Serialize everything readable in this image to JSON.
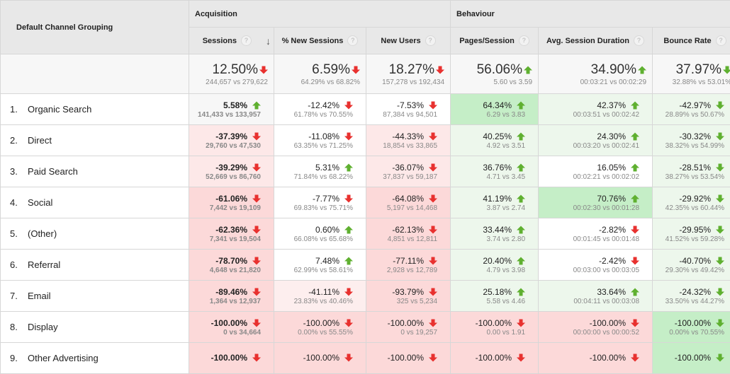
{
  "header": {
    "dimension_label": "Default Channel Grouping",
    "groups": [
      {
        "label": "Acquisition"
      },
      {
        "label": "Behaviour"
      }
    ],
    "metrics": [
      {
        "label": "Sessions",
        "help_icon": "question-icon",
        "sort_icon": "arrow-down-icon"
      },
      {
        "label": "% New Sessions",
        "help_icon": "question-icon"
      },
      {
        "label": "New Users",
        "help_icon": "question-icon"
      },
      {
        "label": "Pages/Session",
        "help_icon": "question-icon"
      },
      {
        "label": "Avg. Session Duration",
        "help_icon": "question-icon"
      },
      {
        "label": "Bounce Rate",
        "help_icon": "question-icon"
      }
    ],
    "help_glyph": "?",
    "sort_glyph": "↓"
  },
  "colors": {
    "arrow_red": "#e8312f",
    "arrow_green": "#5fb030",
    "red_light": "#fde8e8",
    "red_mid": "#fcd9d9",
    "green_strong": "#c5eec7",
    "green_light": "#edf7ec"
  },
  "totals": [
    {
      "value": "12.50%",
      "compare": "244,657 vs 279,622",
      "dir": "down",
      "color": "red"
    },
    {
      "value": "6.59%",
      "compare": "64.29% vs 68.82%",
      "dir": "down",
      "color": "red"
    },
    {
      "value": "18.27%",
      "compare": "157,278 vs 192,434",
      "dir": "down",
      "color": "red"
    },
    {
      "value": "56.06%",
      "compare": "5.60 vs 3.59",
      "dir": "up",
      "color": "green"
    },
    {
      "value": "34.90%",
      "compare": "00:03:21 vs 00:02:29",
      "dir": "up",
      "color": "green"
    },
    {
      "value": "37.97%",
      "compare": "32.88% vs 53.01%",
      "dir": "down",
      "color": "green"
    }
  ],
  "rows": [
    {
      "index": "1.",
      "channel": "Organic Search",
      "cells": [
        {
          "value": "5.58%",
          "compare": "141,433 vs 133,957",
          "dir": "up",
          "color": "green",
          "bg": "n"
        },
        {
          "value": "-12.42%",
          "compare": "61.78% vs 70.55%",
          "dir": "down",
          "color": "red",
          "bg": "w"
        },
        {
          "value": "-7.53%",
          "compare": "87,384 vs 94,501",
          "dir": "down",
          "color": "red",
          "bg": "w"
        },
        {
          "value": "64.34%",
          "compare": "6.29 vs 3.83",
          "dir": "up",
          "color": "green",
          "bg": "g1"
        },
        {
          "value": "42.37%",
          "compare": "00:03:51 vs 00:02:42",
          "dir": "up",
          "color": "green",
          "bg": "g2"
        },
        {
          "value": "-42.97%",
          "compare": "28.89% vs 50.67%",
          "dir": "down",
          "color": "green",
          "bg": "g2"
        }
      ]
    },
    {
      "index": "2.",
      "channel": "Direct",
      "cells": [
        {
          "value": "-37.39%",
          "compare": "29,760 vs 47,530",
          "dir": "down",
          "color": "red",
          "bg": "r1"
        },
        {
          "value": "-11.08%",
          "compare": "63.35% vs 71.25%",
          "dir": "down",
          "color": "red",
          "bg": "w"
        },
        {
          "value": "-44.33%",
          "compare": "18,854 vs 33,865",
          "dir": "down",
          "color": "red",
          "bg": "r1"
        },
        {
          "value": "40.25%",
          "compare": "4.92 vs 3.51",
          "dir": "up",
          "color": "green",
          "bg": "g2"
        },
        {
          "value": "24.30%",
          "compare": "00:03:20 vs 00:02:41",
          "dir": "up",
          "color": "green",
          "bg": "g2"
        },
        {
          "value": "-30.32%",
          "compare": "38.32% vs 54.99%",
          "dir": "down",
          "color": "green",
          "bg": "g2"
        }
      ]
    },
    {
      "index": "3.",
      "channel": "Paid Search",
      "cells": [
        {
          "value": "-39.29%",
          "compare": "52,669 vs 86,760",
          "dir": "down",
          "color": "red",
          "bg": "r1"
        },
        {
          "value": "5.31%",
          "compare": "71.84% vs 68.22%",
          "dir": "up",
          "color": "green",
          "bg": "w"
        },
        {
          "value": "-36.07%",
          "compare": "37,837 vs 59,187",
          "dir": "down",
          "color": "red",
          "bg": "r1"
        },
        {
          "value": "36.76%",
          "compare": "4.71 vs 3.45",
          "dir": "up",
          "color": "green",
          "bg": "g2"
        },
        {
          "value": "16.05%",
          "compare": "00:02:21 vs 00:02:02",
          "dir": "up",
          "color": "green",
          "bg": "w"
        },
        {
          "value": "-28.51%",
          "compare": "38.27% vs 53.54%",
          "dir": "down",
          "color": "green",
          "bg": "g2"
        }
      ]
    },
    {
      "index": "4.",
      "channel": "Social",
      "cells": [
        {
          "value": "-61.06%",
          "compare": "7,442 vs 19,109",
          "dir": "down",
          "color": "red",
          "bg": "r2"
        },
        {
          "value": "-7.77%",
          "compare": "69.83% vs 75.71%",
          "dir": "down",
          "color": "red",
          "bg": "w"
        },
        {
          "value": "-64.08%",
          "compare": "5,197 vs 14,468",
          "dir": "down",
          "color": "red",
          "bg": "r2"
        },
        {
          "value": "41.19%",
          "compare": "3.87 vs 2.74",
          "dir": "up",
          "color": "green",
          "bg": "g2"
        },
        {
          "value": "70.76%",
          "compare": "00:02:30 vs 00:01:28",
          "dir": "up",
          "color": "green",
          "bg": "g1"
        },
        {
          "value": "-29.92%",
          "compare": "42.35% vs 60.44%",
          "dir": "down",
          "color": "green",
          "bg": "g2"
        }
      ]
    },
    {
      "index": "5.",
      "channel": "(Other)",
      "cells": [
        {
          "value": "-62.36%",
          "compare": "7,341 vs 19,504",
          "dir": "down",
          "color": "red",
          "bg": "r2"
        },
        {
          "value": "0.60%",
          "compare": "66.08% vs 65.68%",
          "dir": "up",
          "color": "green",
          "bg": "w"
        },
        {
          "value": "-62.13%",
          "compare": "4,851 vs 12,811",
          "dir": "down",
          "color": "red",
          "bg": "r2"
        },
        {
          "value": "33.44%",
          "compare": "3.74 vs 2.80",
          "dir": "up",
          "color": "green",
          "bg": "g2"
        },
        {
          "value": "-2.82%",
          "compare": "00:01:45 vs 00:01:48",
          "dir": "down",
          "color": "red",
          "bg": "w"
        },
        {
          "value": "-29.95%",
          "compare": "41.52% vs 59.28%",
          "dir": "down",
          "color": "green",
          "bg": "g2"
        }
      ]
    },
    {
      "index": "6.",
      "channel": "Referral",
      "cells": [
        {
          "value": "-78.70%",
          "compare": "4,648 vs 21,820",
          "dir": "down",
          "color": "red",
          "bg": "r2"
        },
        {
          "value": "7.48%",
          "compare": "62.99% vs 58.61%",
          "dir": "up",
          "color": "green",
          "bg": "w"
        },
        {
          "value": "-77.11%",
          "compare": "2,928 vs 12,789",
          "dir": "down",
          "color": "red",
          "bg": "r2"
        },
        {
          "value": "20.40%",
          "compare": "4.79 vs 3.98",
          "dir": "up",
          "color": "green",
          "bg": "g2"
        },
        {
          "value": "-2.42%",
          "compare": "00:03:00 vs 00:03:05",
          "dir": "down",
          "color": "red",
          "bg": "w"
        },
        {
          "value": "-40.70%",
          "compare": "29.30% vs 49.42%",
          "dir": "down",
          "color": "green",
          "bg": "g2"
        }
      ]
    },
    {
      "index": "7.",
      "channel": "Email",
      "cells": [
        {
          "value": "-89.46%",
          "compare": "1,364 vs 12,937",
          "dir": "down",
          "color": "red",
          "bg": "r2"
        },
        {
          "value": "-41.11%",
          "compare": "23.83% vs 40.46%",
          "dir": "down",
          "color": "red",
          "bg": "rw"
        },
        {
          "value": "-93.79%",
          "compare": "325 vs 5,234",
          "dir": "down",
          "color": "red",
          "bg": "r2"
        },
        {
          "value": "25.18%",
          "compare": "5.58 vs 4.46",
          "dir": "up",
          "color": "green",
          "bg": "g2"
        },
        {
          "value": "33.64%",
          "compare": "00:04:11 vs 00:03:08",
          "dir": "up",
          "color": "green",
          "bg": "g2"
        },
        {
          "value": "-24.32%",
          "compare": "33.50% vs 44.27%",
          "dir": "down",
          "color": "green",
          "bg": "g2"
        }
      ]
    },
    {
      "index": "8.",
      "channel": "Display",
      "cells": [
        {
          "value": "-100.00%",
          "compare": "0 vs 34,664",
          "dir": "down",
          "color": "red",
          "bg": "r2"
        },
        {
          "value": "-100.00%",
          "compare": "0.00% vs 55.55%",
          "dir": "down",
          "color": "red",
          "bg": "r2"
        },
        {
          "value": "-100.00%",
          "compare": "0 vs 19,257",
          "dir": "down",
          "color": "red",
          "bg": "r2"
        },
        {
          "value": "-100.00%",
          "compare": "0.00 vs 1.91",
          "dir": "down",
          "color": "red",
          "bg": "r2"
        },
        {
          "value": "-100.00%",
          "compare": "00:00:00 vs 00:00:52",
          "dir": "down",
          "color": "red",
          "bg": "r2"
        },
        {
          "value": "-100.00%",
          "compare": "0.00% vs 70.55%",
          "dir": "down",
          "color": "green",
          "bg": "g1"
        }
      ]
    },
    {
      "index": "9.",
      "channel": "Other Advertising",
      "cells": [
        {
          "value": "-100.00%",
          "compare": "",
          "dir": "down",
          "color": "red",
          "bg": "r2"
        },
        {
          "value": "-100.00%",
          "compare": "",
          "dir": "down",
          "color": "red",
          "bg": "r2"
        },
        {
          "value": "-100.00%",
          "compare": "",
          "dir": "down",
          "color": "red",
          "bg": "r2"
        },
        {
          "value": "-100.00%",
          "compare": "",
          "dir": "down",
          "color": "red",
          "bg": "r2"
        },
        {
          "value": "-100.00%",
          "compare": "",
          "dir": "down",
          "color": "red",
          "bg": "r2"
        },
        {
          "value": "-100.00%",
          "compare": "",
          "dir": "down",
          "color": "green",
          "bg": "g1"
        }
      ]
    }
  ]
}
